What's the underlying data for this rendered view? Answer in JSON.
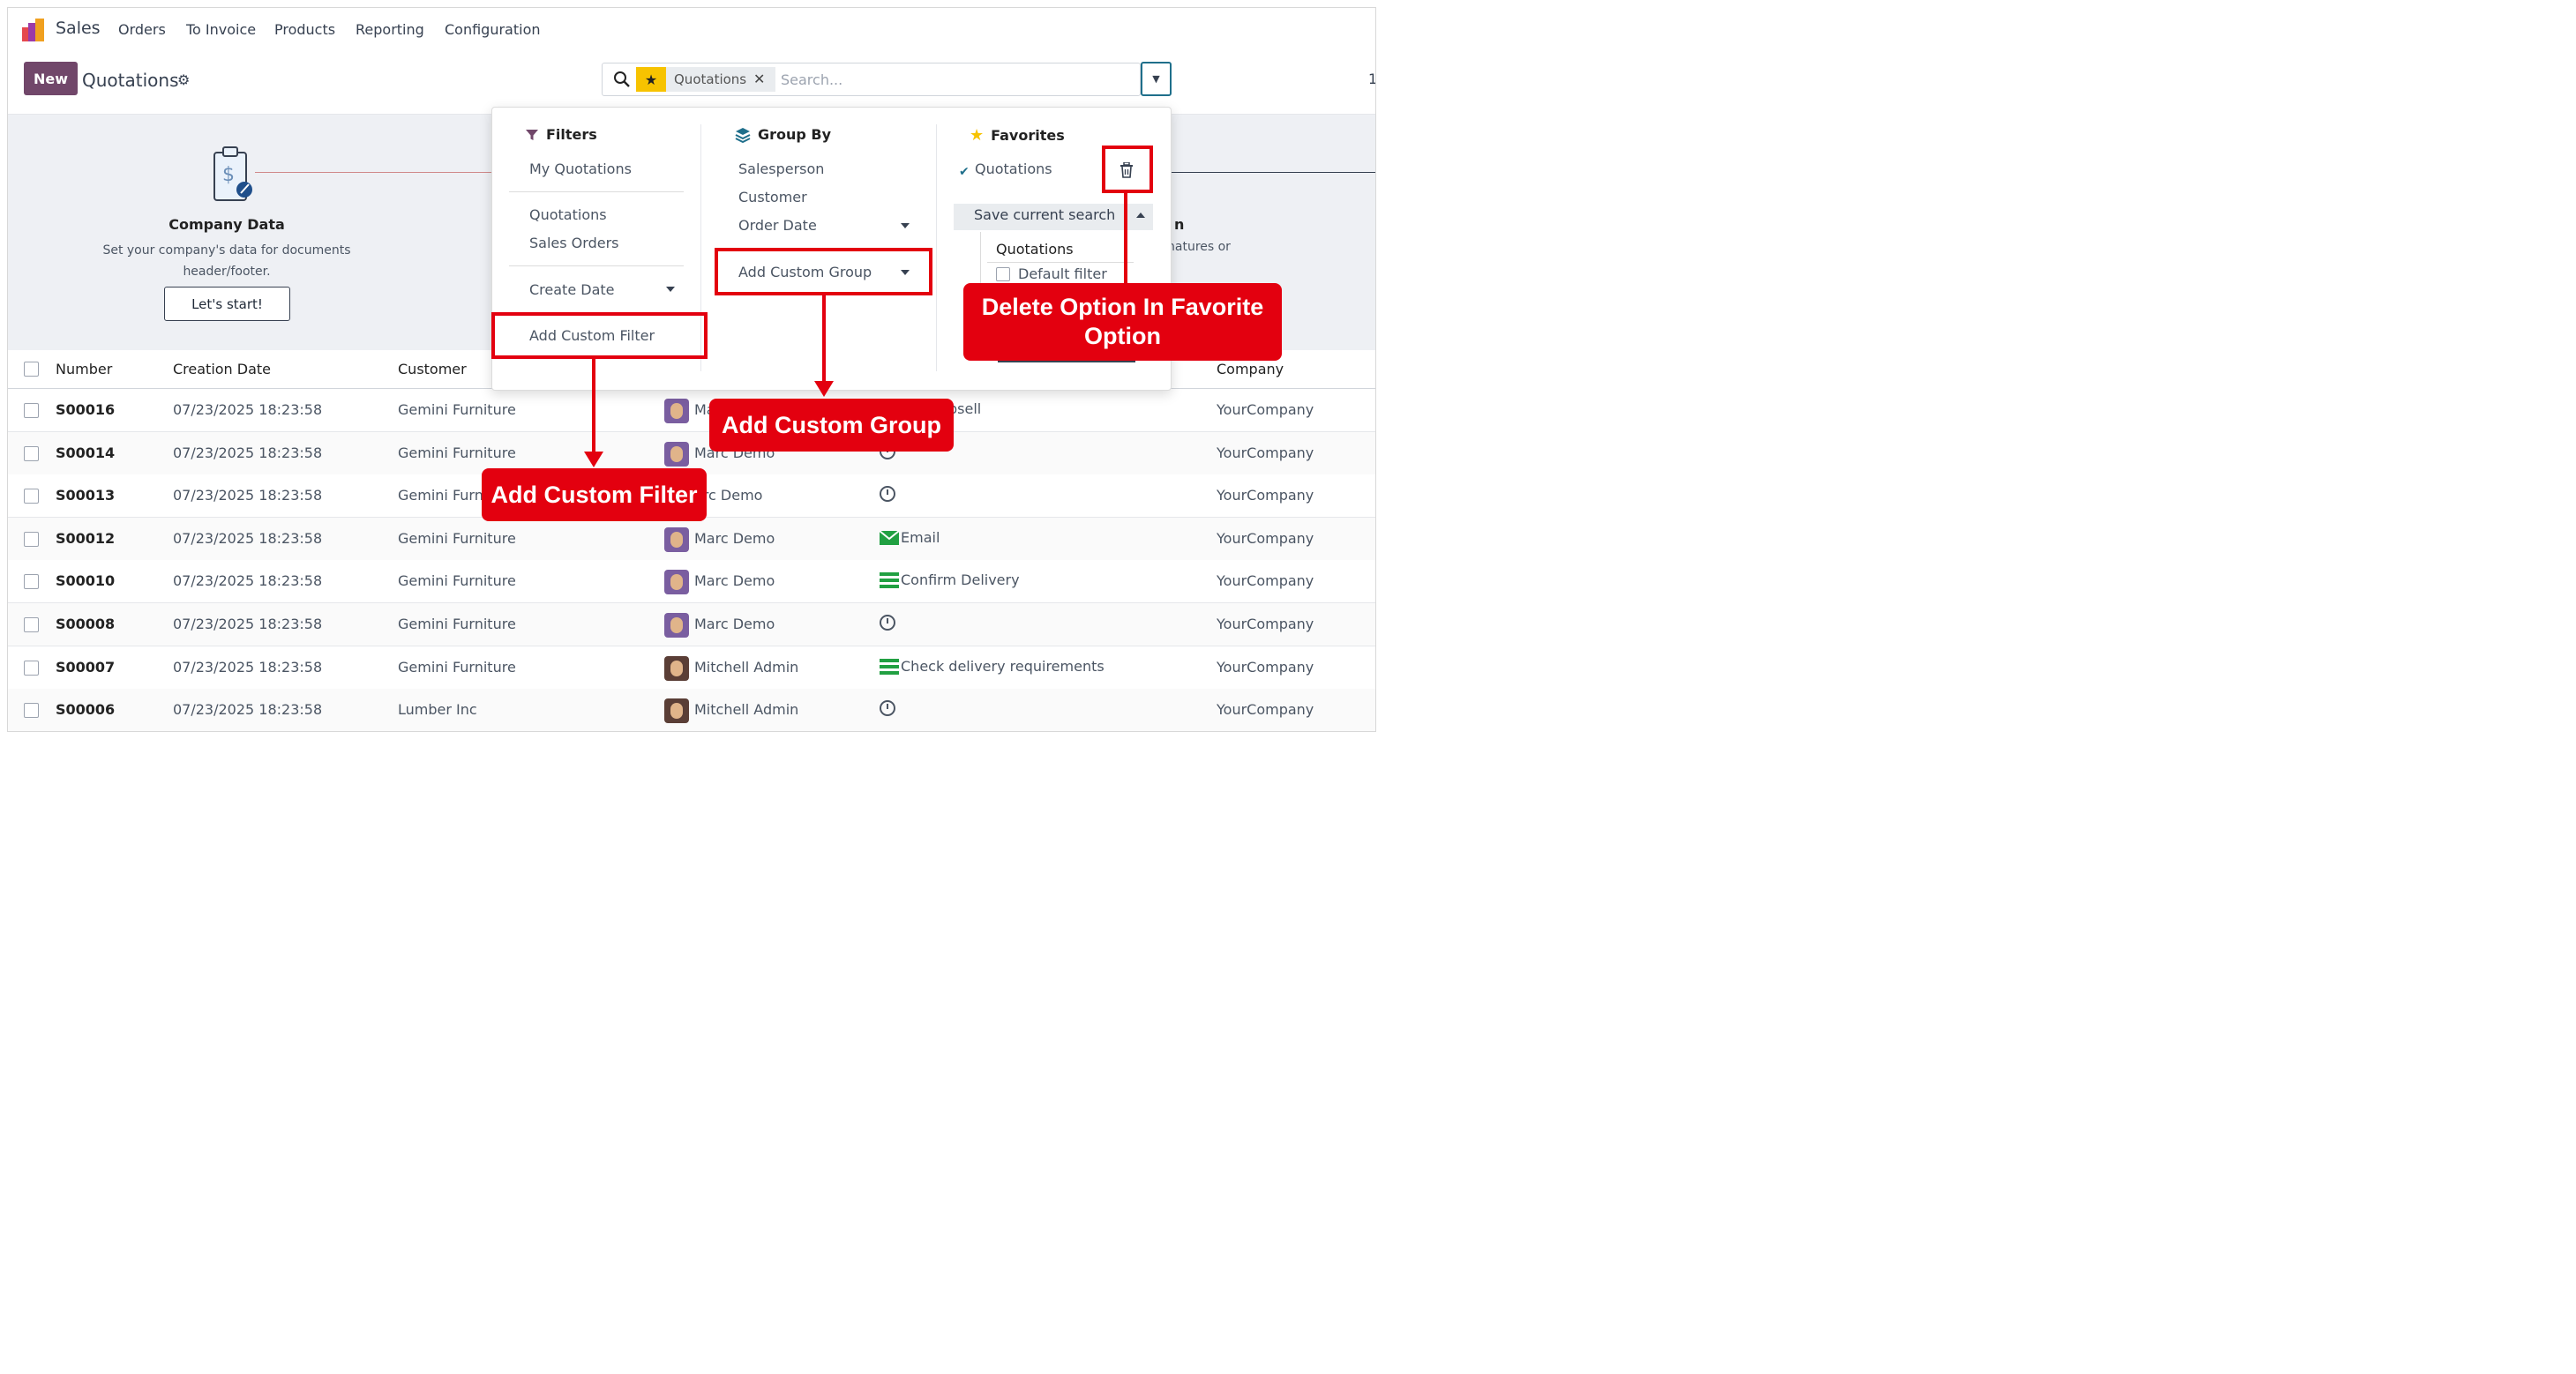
{
  "navbar": {
    "app_name": "Sales",
    "menu": [
      "Orders",
      "To Invoice",
      "Products",
      "Reporting",
      "Configuration"
    ]
  },
  "control": {
    "new_label": "New",
    "title": "Quotations",
    "facet": "Quotations",
    "search_placeholder": "Search...",
    "pager": "1"
  },
  "banner": {
    "left_title": "Company Data",
    "left_desc_1": "Set your company's data for documents",
    "left_desc_2": "header/footer.",
    "left_button": "Let's start!",
    "right_title_fragment": "n",
    "right_desc_fragment": "natures or"
  },
  "dropdown": {
    "filters": {
      "title": "Filters",
      "items": [
        "My Quotations",
        "Quotations",
        "Sales Orders",
        "Create Date",
        "Add Custom Filter"
      ]
    },
    "group_by": {
      "title": "Group By",
      "items": [
        "Salesperson",
        "Customer",
        "Order Date",
        "Add Custom Group"
      ]
    },
    "favorites": {
      "title": "Favorites",
      "active": "Quotations",
      "save_label": "Save current search",
      "save_name": "Quotations",
      "default_filter": "Default filter"
    }
  },
  "table": {
    "headers": [
      "Number",
      "Creation Date",
      "Customer",
      "Company"
    ],
    "rows": [
      {
        "number": "S00016",
        "date": "07/23/2025 18:23:58",
        "customer": "Gemini Furniture",
        "salesperson": "Ma",
        "activity": "psell",
        "activity_icon": "none",
        "company": "YourCompany"
      },
      {
        "number": "S00014",
        "date": "07/23/2025 18:23:58",
        "customer": "Gemini Furniture",
        "salesperson": "Marc Demo",
        "activity": "",
        "activity_icon": "clock",
        "company": "YourCompany"
      },
      {
        "number": "S00013",
        "date": "07/23/2025 18:23:58",
        "customer": "Gemini Furni",
        "salesperson": "arc Demo",
        "activity": "",
        "activity_icon": "clock",
        "company": "YourCompany"
      },
      {
        "number": "S00012",
        "date": "07/23/2025 18:23:58",
        "customer": "Gemini Furniture",
        "salesperson": "Marc Demo",
        "activity": "Email",
        "activity_icon": "envelope",
        "company": "YourCompany"
      },
      {
        "number": "S00010",
        "date": "07/23/2025 18:23:58",
        "customer": "Gemini Furniture",
        "salesperson": "Marc Demo",
        "activity": "Confirm Delivery",
        "activity_icon": "tasks",
        "company": "YourCompany"
      },
      {
        "number": "S00008",
        "date": "07/23/2025 18:23:58",
        "customer": "Gemini Furniture",
        "salesperson": "Marc Demo",
        "activity": "",
        "activity_icon": "clock",
        "company": "YourCompany"
      },
      {
        "number": "S00007",
        "date": "07/23/2025 18:23:58",
        "customer": "Gemini Furniture",
        "salesperson": "Mitchell Admin",
        "activity": "Check delivery requirements",
        "activity_icon": "tasks",
        "company": "YourCompany"
      },
      {
        "number": "S00006",
        "date": "07/23/2025 18:23:58",
        "customer": "Lumber Inc",
        "salesperson": "Mitchell Admin",
        "activity": "",
        "activity_icon": "clock",
        "company": "YourCompany"
      }
    ]
  },
  "annotations": {
    "custom_filter": "Add Custom Filter",
    "custom_group": "Add Custom Group",
    "delete_favorite": "Delete Option In Favorite Option"
  },
  "colors": {
    "brand": "#71476a",
    "accent": "#1f6f8b",
    "annotation": "#e3000f",
    "favorite_star": "#f7c300",
    "activity_green": "#21a042"
  }
}
